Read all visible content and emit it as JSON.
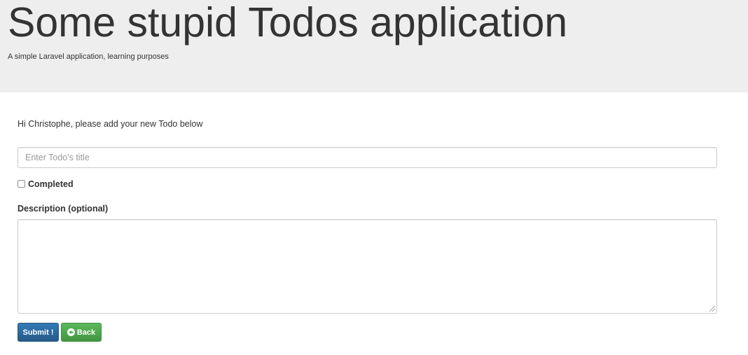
{
  "header": {
    "title": "Some stupid Todos application",
    "subtitle": "A simple Laravel application, learning purposes"
  },
  "form": {
    "greeting": "Hi Christophe, please add your new Todo below",
    "title_placeholder": "Enter Todo's title",
    "title_value": "",
    "completed_label": "Completed",
    "completed_checked": false,
    "description_label": "Description (optional)",
    "description_value": "",
    "submit_label": "Submit !",
    "back_label": "Back",
    "back_icon": "circle-arrow-left-icon"
  },
  "colors": {
    "jumbotron_bg": "#eeeeee",
    "primary": "#337ab7",
    "success": "#5cb85c"
  }
}
